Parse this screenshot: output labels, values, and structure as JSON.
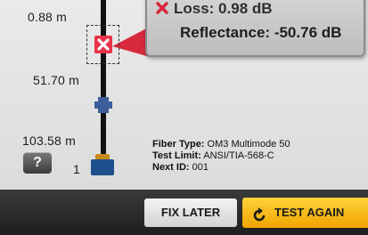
{
  "trace": {
    "distances": [
      "0.88 m",
      "51.70 m",
      "103.58 m"
    ],
    "end_label": "1"
  },
  "popup": {
    "loss_label": "Loss: 0.98 dB",
    "reflectance_label": "Reflectance: -50.76 dB"
  },
  "info": {
    "fiber_type_key": "Fiber Type:",
    "fiber_type_value": "OM3 Multimode 50",
    "test_limit_key": "Test Limit:",
    "test_limit_value": "ANSI/TIA-568-C",
    "next_id_key": "Next ID:",
    "next_id_value": "001"
  },
  "help_label": "?",
  "buttons": {
    "fix_later": "FIX LATER",
    "test_again": "TEST AGAIN"
  },
  "colors": {
    "fail_marker": "#e8334a",
    "connector": "#3b5e9a",
    "test_again_button": "#f7bb1a"
  },
  "icons": {
    "event": "fail-x-icon",
    "test_again": "refresh-icon",
    "help": "help-icon"
  }
}
